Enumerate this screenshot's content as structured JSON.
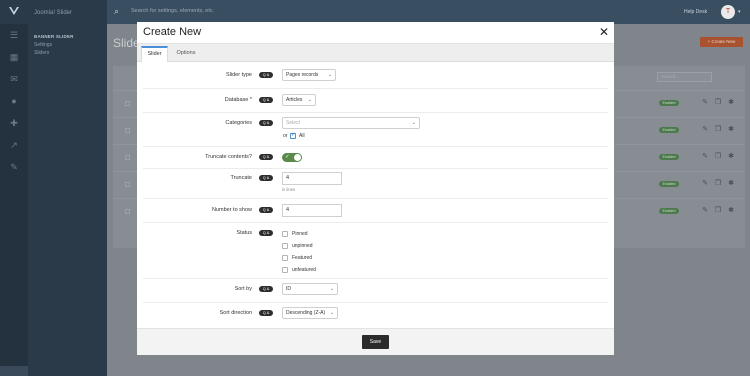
{
  "background": {
    "app_name": "Joomla! Slider",
    "nav_title": "BANNER SLIDER",
    "nav_items": [
      "Settings",
      "Sliders"
    ],
    "search_placeholder": "Search for settings, elements, etc.",
    "help_label": "Help Desk",
    "avatar_initial": "T",
    "page_title": "Slide",
    "create_button": "+ Create New",
    "list_search_placeholder": "Search...",
    "rows": [
      {
        "status": "Enabled"
      },
      {
        "status": "Enabled"
      },
      {
        "status": "Enabled"
      },
      {
        "status": "Enabled"
      },
      {
        "status": "Enabled"
      }
    ]
  },
  "modal": {
    "title": "Create New",
    "close_icon": "close-icon",
    "tabs": [
      {
        "label": "Slider",
        "active": true
      },
      {
        "label": "Options",
        "active": false
      }
    ],
    "badge_text": "Q &",
    "fields": {
      "slider_type": {
        "label": "Slider type",
        "value": "Pages records"
      },
      "database": {
        "label": "Database *",
        "value": "Articles"
      },
      "categories": {
        "label": "Categories",
        "placeholder": "Select",
        "or_label": "or",
        "all_label": "All",
        "all_checked": true
      },
      "truncate_contents": {
        "label": "Truncate contents?",
        "enabled": true
      },
      "truncate": {
        "label": "Truncate",
        "value": "4",
        "hint": "in lines"
      },
      "number_to_show": {
        "label": "Number to show",
        "value": "4"
      },
      "status": {
        "label": "Status",
        "options": [
          "Pinned",
          "unpinned",
          "Featured",
          "unfeatured"
        ]
      },
      "sort_by": {
        "label": "Sort by",
        "value": "ID"
      },
      "sort_direction": {
        "label": "Sort direction",
        "value": "Descending (Z-A)"
      }
    },
    "save_label": "Save"
  },
  "colors": {
    "toggle_on": "#5a8a4a",
    "active_tab_accent": "#4a90d9",
    "save_button": "#2b2b2b",
    "create_button": "#a9522f"
  }
}
